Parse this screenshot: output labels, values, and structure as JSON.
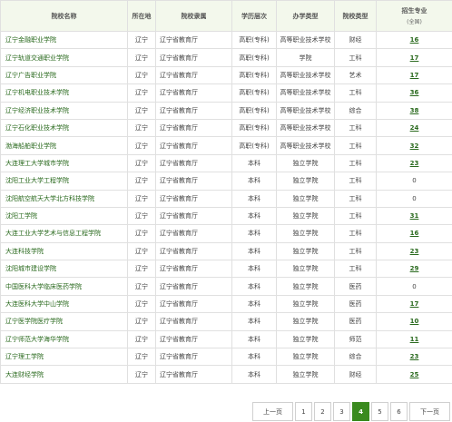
{
  "headers": {
    "name": "院校名称",
    "location": "所在地",
    "authority": "院校隶属",
    "level": "学历层次",
    "type": "办学类型",
    "category": "院校类型",
    "majors": "招生专业",
    "majors_sub": "(全国)"
  },
  "rows": [
    {
      "name": "辽宁金融职业学院",
      "location": "辽宁",
      "authority": "辽宁省教育厅",
      "level": "高职(专科)",
      "type": "高等职业技术学校",
      "category": "财经",
      "majors": "16"
    },
    {
      "name": "辽宁轨道交通职业学院",
      "location": "辽宁",
      "authority": "辽宁省教育厅",
      "level": "高职(专科)",
      "type": "学院",
      "category": "工科",
      "majors": "17"
    },
    {
      "name": "辽宁广告职业学院",
      "location": "辽宁",
      "authority": "辽宁省教育厅",
      "level": "高职(专科)",
      "type": "高等职业技术学校",
      "category": "艺术",
      "majors": "17"
    },
    {
      "name": "辽宁机电职业技术学院",
      "location": "辽宁",
      "authority": "辽宁省教育厅",
      "level": "高职(专科)",
      "type": "高等职业技术学校",
      "category": "工科",
      "majors": "36"
    },
    {
      "name": "辽宁经济职业技术学院",
      "location": "辽宁",
      "authority": "辽宁省教育厅",
      "level": "高职(专科)",
      "type": "高等职业技术学校",
      "category": "综合",
      "majors": "38"
    },
    {
      "name": "辽宁石化职业技术学院",
      "location": "辽宁",
      "authority": "辽宁省教育厅",
      "level": "高职(专科)",
      "type": "高等职业技术学校",
      "category": "工科",
      "majors": "24"
    },
    {
      "name": "渤海船舶职业学院",
      "location": "辽宁",
      "authority": "辽宁省教育厅",
      "level": "高职(专科)",
      "type": "高等职业技术学校",
      "category": "工科",
      "majors": "32"
    },
    {
      "name": "大连理工大学城市学院",
      "location": "辽宁",
      "authority": "辽宁省教育厅",
      "level": "本科",
      "type": "独立学院",
      "category": "工科",
      "majors": "23"
    },
    {
      "name": "沈阳工业大学工程学院",
      "location": "辽宁",
      "authority": "辽宁省教育厅",
      "level": "本科",
      "type": "独立学院",
      "category": "工科",
      "majors": "0"
    },
    {
      "name": "沈阳航空航天大学北方科技学院",
      "location": "辽宁",
      "authority": "辽宁省教育厅",
      "level": "本科",
      "type": "独立学院",
      "category": "工科",
      "majors": "0"
    },
    {
      "name": "沈阳工学院",
      "location": "辽宁",
      "authority": "辽宁省教育厅",
      "level": "本科",
      "type": "独立学院",
      "category": "工科",
      "majors": "31"
    },
    {
      "name": "大连工业大学艺术与信息工程学院",
      "location": "辽宁",
      "authority": "辽宁省教育厅",
      "level": "本科",
      "type": "独立学院",
      "category": "工科",
      "majors": "16"
    },
    {
      "name": "大连科技学院",
      "location": "辽宁",
      "authority": "辽宁省教育厅",
      "level": "本科",
      "type": "独立学院",
      "category": "工科",
      "majors": "23"
    },
    {
      "name": "沈阳城市建设学院",
      "location": "辽宁",
      "authority": "辽宁省教育厅",
      "level": "本科",
      "type": "独立学院",
      "category": "工科",
      "majors": "29"
    },
    {
      "name": "中国医科大学临床医药学院",
      "location": "辽宁",
      "authority": "辽宁省教育厅",
      "level": "本科",
      "type": "独立学院",
      "category": "医药",
      "majors": "0"
    },
    {
      "name": "大连医科大学中山学院",
      "location": "辽宁",
      "authority": "辽宁省教育厅",
      "level": "本科",
      "type": "独立学院",
      "category": "医药",
      "majors": "17"
    },
    {
      "name": "辽宁医学院医疗学院",
      "location": "辽宁",
      "authority": "辽宁省教育厅",
      "level": "本科",
      "type": "独立学院",
      "category": "医药",
      "majors": "10"
    },
    {
      "name": "辽宁师范大学海华学院",
      "location": "辽宁",
      "authority": "辽宁省教育厅",
      "level": "本科",
      "type": "独立学院",
      "category": "师范",
      "majors": "11"
    },
    {
      "name": "辽宁理工学院",
      "location": "辽宁",
      "authority": "辽宁省教育厅",
      "level": "本科",
      "type": "独立学院",
      "category": "综合",
      "majors": "23"
    },
    {
      "name": "大连财经学院",
      "location": "辽宁",
      "authority": "辽宁省教育厅",
      "level": "本科",
      "type": "独立学院",
      "category": "财经",
      "majors": "25"
    }
  ],
  "pagination": {
    "prev": "上一页",
    "pages": [
      "1",
      "2",
      "3",
      "4",
      "5",
      "6"
    ],
    "current": "4",
    "next": "下一页"
  }
}
